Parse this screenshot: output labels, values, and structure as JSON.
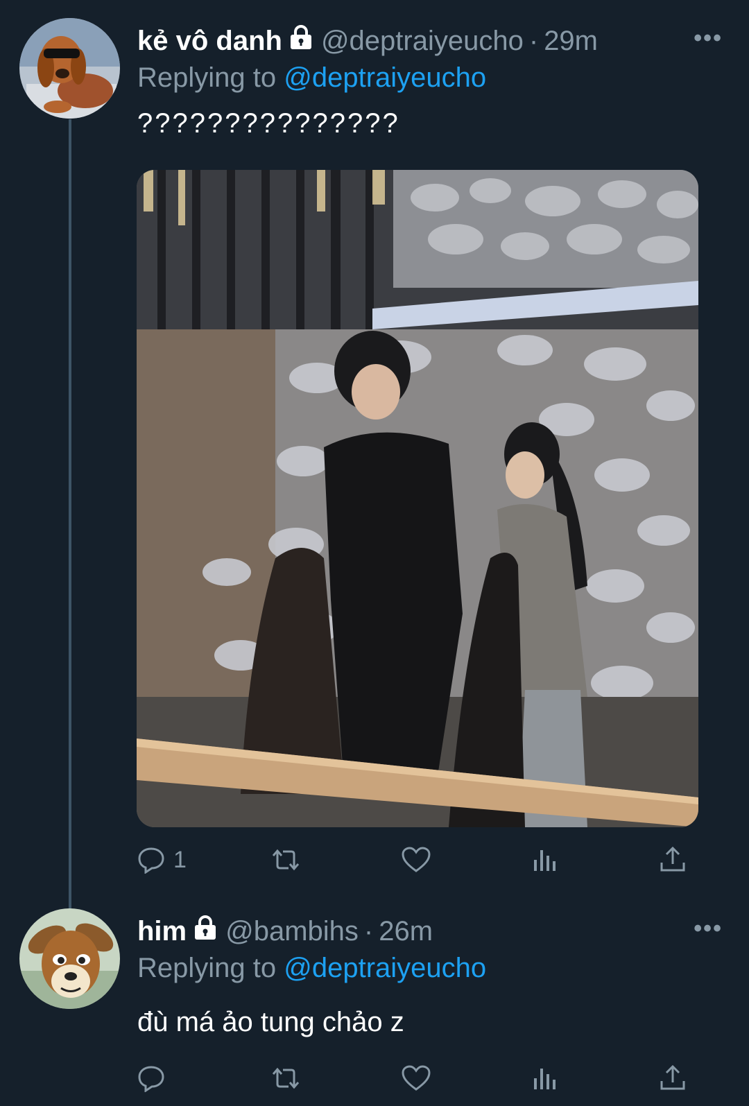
{
  "tweets": [
    {
      "name": "kẻ vô danh",
      "handle": "@deptraiyeucho",
      "separator": "·",
      "time": "29m",
      "replying_label": "Replying to",
      "replying_to": "@deptraiyeucho",
      "text": "???????????????",
      "actions": {
        "reply_count": "1",
        "retweet_count": "",
        "like_count": ""
      }
    },
    {
      "name": "him",
      "handle": "@bambihs",
      "separator": "·",
      "time": "26m",
      "replying_label": "Replying to",
      "replying_to": "@deptraiyeucho",
      "text": "đù má ảo tung chảo z",
      "actions": {
        "reply_count": "",
        "retweet_count": "",
        "like_count": ""
      }
    }
  ],
  "colors": {
    "background": "#15202b",
    "secondary_text": "#8899a6",
    "mention": "#1da1f2",
    "thread_line": "#3d5466"
  },
  "icons": [
    "lock-icon",
    "more-icon",
    "reply-icon",
    "retweet-icon",
    "like-icon",
    "analytics-icon",
    "share-icon"
  ]
}
